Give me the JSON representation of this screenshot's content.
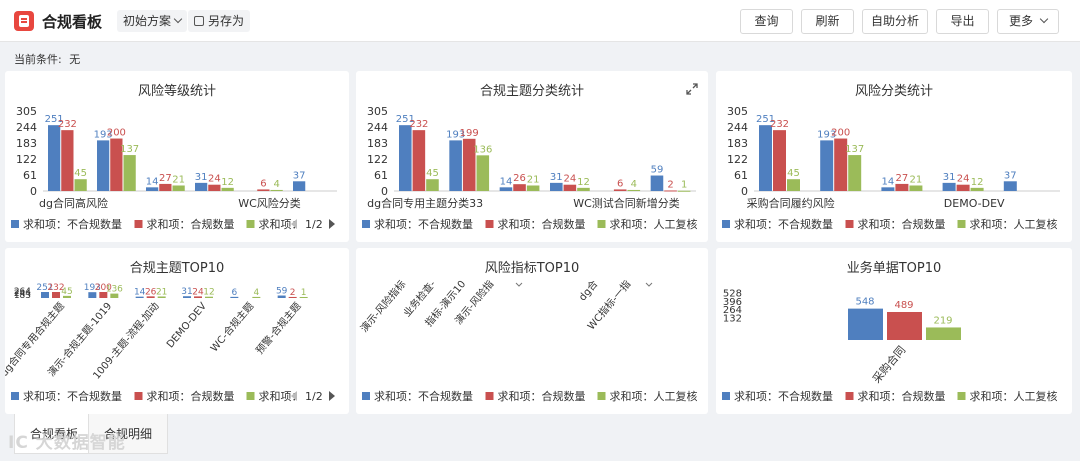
{
  "header": {
    "title": "合规看板",
    "plan_label": "初始方案",
    "saveas_label": "另存为",
    "buttons": [
      "查询",
      "刷新",
      "自助分析",
      "导出",
      "更多"
    ]
  },
  "conditions": {
    "label": "当前条件:",
    "value": "无"
  },
  "colors": {
    "blue": "#4f7fbf",
    "red": "#c9504f",
    "green": "#9bbb59",
    "accent": "#e8473f"
  },
  "legend_series": [
    "求和项：不合规数量",
    "求和项：合规数量",
    "求和项：人工复核合规"
  ],
  "pager": "1/2",
  "tabs": [
    "合规看板",
    "合规明细"
  ],
  "watermark": "大数据智能",
  "chart_data": [
    {
      "title": "风险等级统计",
      "type": "bar",
      "yticks": [
        0,
        61,
        122,
        183,
        244,
        305
      ],
      "ylim": [
        0,
        305
      ],
      "categories": [
        "dg合同高风险",
        "",
        "",
        "",
        "WC风险分类",
        ""
      ],
      "xlabels_show": [
        "dg合同高风险",
        "WC风险分类"
      ],
      "series": [
        {
          "name": "求和项：不合规数量",
          "values": [
            251,
            193,
            14,
            31,
            null,
            37
          ]
        },
        {
          "name": "求和项：合规数量",
          "values": [
            232,
            200,
            27,
            24,
            6,
            null
          ]
        },
        {
          "name": "求和项：人工复核合规",
          "values": [
            45,
            137,
            21,
            12,
            4,
            null
          ]
        }
      ],
      "legend_visible": 3,
      "pager": true
    },
    {
      "title": "合规主题分类统计",
      "type": "bar",
      "yticks": [
        0,
        61,
        122,
        183,
        244,
        305
      ],
      "ylim": [
        0,
        305
      ],
      "categories": [
        "dg合同专用主题分类33",
        "",
        "",
        "",
        "WC测试合同新增分类",
        ""
      ],
      "xlabels_show": [
        "dg合同专用主题分类33",
        "WC测试合同新增分类"
      ],
      "series": [
        {
          "name": "求和项：不合规数量",
          "values": [
            251,
            193,
            14,
            31,
            null,
            59
          ]
        },
        {
          "name": "求和项：合规数量",
          "values": [
            232,
            199,
            26,
            24,
            6,
            2
          ]
        },
        {
          "name": "求和项：人工复核合规",
          "values": [
            45,
            136,
            21,
            12,
            4,
            1
          ]
        }
      ],
      "legend_visible": 3,
      "pager": false
    },
    {
      "title": "风险分类统计",
      "type": "bar",
      "yticks": [
        0,
        61,
        122,
        183,
        244,
        305
      ],
      "ylim": [
        0,
        305
      ],
      "categories": [
        "采购合同履约风险",
        "",
        "",
        "DEMO-DEV",
        ""
      ],
      "xlabels_show": [
        "采购合同履约风险",
        "DEMO-DEV"
      ],
      "series": [
        {
          "name": "求和项：不合规数量",
          "values": [
            251,
            193,
            14,
            31,
            37
          ]
        },
        {
          "name": "求和项：合规数量",
          "values": [
            232,
            200,
            27,
            24,
            null
          ]
        },
        {
          "name": "求和项：人工复核合规",
          "values": [
            45,
            137,
            21,
            12,
            null
          ]
        }
      ],
      "legend_visible": 3,
      "pager": false
    },
    {
      "title": "合规主题TOP10",
      "type": "bar",
      "yticks": [
        "264",
        "244",
        "183"
      ],
      "ylim": [
        0,
        305
      ],
      "categories": [
        "dg合同专用合规主题",
        "演示-合规主题-1019",
        "1009-主题-流程-加动",
        "DEMO-DEV",
        "WC-合规主题",
        "预警-合规主题"
      ],
      "series": [
        {
          "name": "求和项：不合规数量",
          "values": [
            251,
            193,
            14,
            31,
            6,
            59
          ]
        },
        {
          "name": "求和项：合规数量",
          "values": [
            232,
            200,
            26,
            24,
            null,
            2
          ]
        },
        {
          "name": "求和项：人工复核合规",
          "values": [
            45,
            136,
            21,
            12,
            4,
            1
          ]
        }
      ],
      "legend_visible": 3,
      "pager": true
    },
    {
      "title": "风险指标TOP10",
      "type": "bar",
      "categories": [
        "演示-风险指标",
        "业务检查-",
        "指标-演示10",
        "演示-风险指",
        "dg合",
        "WC指标-一指"
      ],
      "series": [
        {
          "name": "求和项：不合规数量",
          "values": []
        },
        {
          "name": "求和项：合规数量",
          "values": []
        },
        {
          "name": "求和项：人工复核合规",
          "values": []
        }
      ],
      "legend_visible": 3,
      "pager": false
    },
    {
      "title": "业务单据TOP10",
      "type": "bar",
      "yticks": [
        132,
        264,
        396,
        528
      ],
      "ylim": [
        0,
        660
      ],
      "categories": [
        "采购合同"
      ],
      "series": [
        {
          "name": "求和项：不合规数量",
          "values": [
            548
          ]
        },
        {
          "name": "求和项：合规数量",
          "values": [
            489
          ]
        },
        {
          "name": "求和项：人工复核合规",
          "values": [
            219
          ]
        }
      ],
      "legend_visible": 3,
      "pager": false
    }
  ]
}
